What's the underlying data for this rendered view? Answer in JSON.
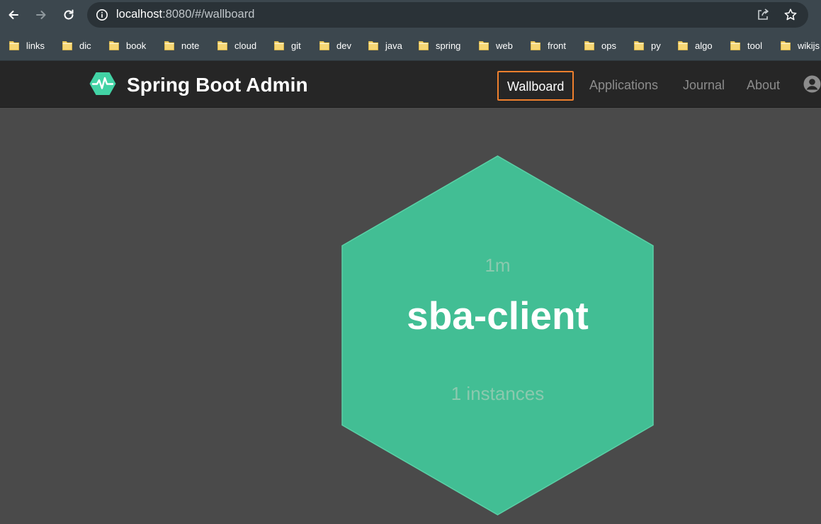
{
  "browser": {
    "url_host": "localhost",
    "url_rest": ":8080/#/wallboard"
  },
  "bookmarks": [
    "links",
    "dic",
    "book",
    "note",
    "cloud",
    "git",
    "dev",
    "java",
    "spring",
    "web",
    "front",
    "ops",
    "py",
    "algo",
    "tool",
    "wikijs"
  ],
  "navbar": {
    "title": "Spring Boot Admin",
    "links": [
      "Wallboard",
      "Applications",
      "Journal",
      "About"
    ],
    "active_link": "Wallboard",
    "accent_color": "#ee7f2d"
  },
  "wallboard": {
    "application": {
      "time": "1m",
      "name": "sba-client",
      "instances": "1 instances",
      "status_color": "#42be94"
    }
  },
  "icons": [
    "back-arrow-icon",
    "forward-arrow-icon",
    "reload-icon",
    "info-icon",
    "share-icon",
    "star-icon",
    "folder-icon",
    "sba-logo-icon",
    "user-icon"
  ]
}
